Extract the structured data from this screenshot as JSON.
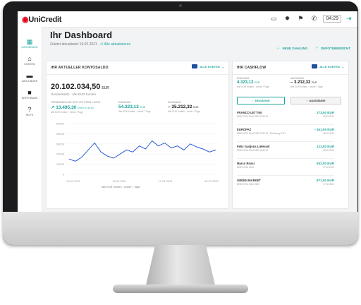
{
  "brand": {
    "name": "UniCredit"
  },
  "topbar": {
    "time": "04:29",
    "icons": [
      "screen-icon",
      "gear-icon",
      "flag-icon",
      "phone-icon",
      "exit-icon"
    ]
  },
  "sidebar": {
    "items": [
      {
        "label": "DASHBOARD",
        "icon": "dashboard-icon",
        "active": true
      },
      {
        "label": "KONTEN",
        "icon": "bank-icon"
      },
      {
        "label": "ZAHLUNGEN",
        "icon": "wallet-icon"
      },
      {
        "label": "DEPOTBANK",
        "icon": "briefcase-icon"
      },
      {
        "label": "HILFE",
        "icon": "help-icon"
      }
    ]
  },
  "page": {
    "title": "Ihr Dashboard",
    "subtitle": "Zuletzt aktualisiert 19.02.2021 · ",
    "subtitle_link": "↺ Alle aktualisieren",
    "action_1": "NEUE ZAHLUNG",
    "action_2": "DEPOTÜBERSICHT"
  },
  "balance_card": {
    "heading": "IHR AKTUELLER KONTOSALDO",
    "selector": "ALLE KONTEN",
    "amount": "20.102.034,50",
    "unit": "EUR",
    "sub": "Gesamtsaldo · Alle EUR Konten",
    "kpis": [
      {
        "label": "VERÄNDERUNG SEIT LETZTEM LOGIN",
        "value": "↗ 13.495,30",
        "unit": "EUR  (+0,14%)",
        "sub": "Alle EUR Konten · Letzte 7 Tage"
      },
      {
        "label": "EINGANG",
        "value": "54.323,12",
        "unit": "EUR",
        "sub": "Alle EUR Konten · Letzte 7 Tage"
      },
      {
        "label": "AUSGANG",
        "value": "– 35.212,32",
        "unit": "EUR",
        "sub": "Alle EUR Konten · Letzte 7 Tage"
      }
    ],
    "legend": "Alle EUR Konten · Letzte 7 Tage"
  },
  "chart_data": {
    "type": "line",
    "ylim": [
      0,
      50000
    ],
    "y_ticks": [
      "50000",
      "40000",
      "30000",
      "20000",
      "10000",
      "0"
    ],
    "x_ticks": [
      "10.01.2021",
      "15.01.2021",
      "17.01.2021",
      "20.01.2021"
    ],
    "series": [
      {
        "color": "#2a5bd7",
        "values": [
          15000,
          13000,
          17000,
          24000,
          31000,
          22000,
          18000,
          16000,
          20000,
          24000,
          22000,
          28000,
          25000,
          33000,
          28000,
          31000,
          26000,
          28000,
          24000,
          30000,
          27000,
          25000,
          22000,
          24000
        ]
      }
    ]
  },
  "cashflow_card": {
    "heading": "IHR CASHFLOW",
    "selector": "ALLE KONTEN",
    "eingang_label": "EINGANG",
    "eingang_value": "4.323,12",
    "eingang_unit": "EUR",
    "eingang_sub": "Alle EUR Konten · Letzte 7 Tage",
    "ausgang_label": "AUSGANG",
    "ausgang_value": "– 3.212,32",
    "ausgang_unit": "EUR",
    "ausgang_sub": "Alle EUR Konten · Letzte 7 Tage",
    "btn_in": "EINGÄNGE",
    "btn_out": "AUSGÄNGE",
    "transactions": [
      {
        "name": "FRANCO LETTINI",
        "detail": "DE89 3704 0044 0532 0130 00",
        "amount": "273,00 EUR",
        "date": "18.02.2021"
      },
      {
        "name": "EUROPAZ",
        "detail": "DE89 3704 0044 0532 0130 00 | Rechnung 4711",
        "amount": "– 341,00 EUR",
        "date": "18.02.2021"
      },
      {
        "name": "Felix Gudjons Lieferant",
        "detail": "DE89 3704 0044 0532 0130 00",
        "amount": "123,00 EUR",
        "date": "18.02.2021"
      },
      {
        "name": "Marco Rossi",
        "detail": "DE89 3704 0044",
        "amount": "932,00 EUR",
        "date": "17.02.2021"
      },
      {
        "name": "GREEN MARKET",
        "detail": "DE89 3704 0044 0532",
        "amount": "871,00 EUR",
        "date": "17.02.2021"
      }
    ]
  }
}
